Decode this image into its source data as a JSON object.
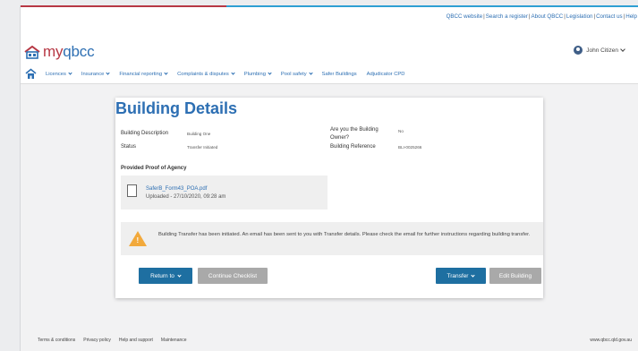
{
  "top_links": {
    "website": "QBCC website",
    "search_register": "Search a register",
    "about": "About QBCC",
    "legislation": "Legislation",
    "contact": "Contact us",
    "help": "Help"
  },
  "header": {
    "logo_prefix": "my",
    "logo_name": "qbcc",
    "user_name": "John Citizen"
  },
  "nav": [
    {
      "label": "Licences"
    },
    {
      "label": "Insurance"
    },
    {
      "label": "Financial reporting"
    },
    {
      "label": "Complaints & disputes"
    },
    {
      "label": "Plumbing"
    },
    {
      "label": "Pool safety"
    },
    {
      "label": "Safer Buildings"
    },
    {
      "label": "Adjudicator CPD"
    }
  ],
  "details": {
    "title": "Building Details",
    "building_description_label": "Building Description",
    "building_description_value": "Building One",
    "status_label": "Status",
    "status_value": "Transfer Initiated",
    "owner_label_line1": "Are you the Building",
    "owner_label_line2": "Owner?",
    "owner_value": "No",
    "reference_label": "Building Reference",
    "reference_value": "BLI-0025266",
    "proof_heading": "Provided Proof of Agency",
    "file_name": "SaferB_Form43_POA.pdf",
    "file_uploaded": "Uploaded - 27/10/2020, 09:28 am",
    "alert_text": "Building Transfer has been initiated. An email has been sent to you with Transfer details. Please check the email for further instructions regarding building transfer."
  },
  "buttons": {
    "return_to": "Return to",
    "continue_checklist": "Continue Checklist",
    "transfer": "Transfer",
    "edit_building": "Edit Building"
  },
  "footer": {
    "terms": "Terms & conditions",
    "privacy": "Privacy policy",
    "help_support": "Help and support",
    "maintenance": "Maintenance",
    "site": "www.qbcc.qld.gov.au"
  },
  "colors": {
    "brand_blue": "#2d6fb3",
    "brand_red": "#b73844",
    "primary_button": "#1e6fa1",
    "warning": "#f2a93b"
  }
}
